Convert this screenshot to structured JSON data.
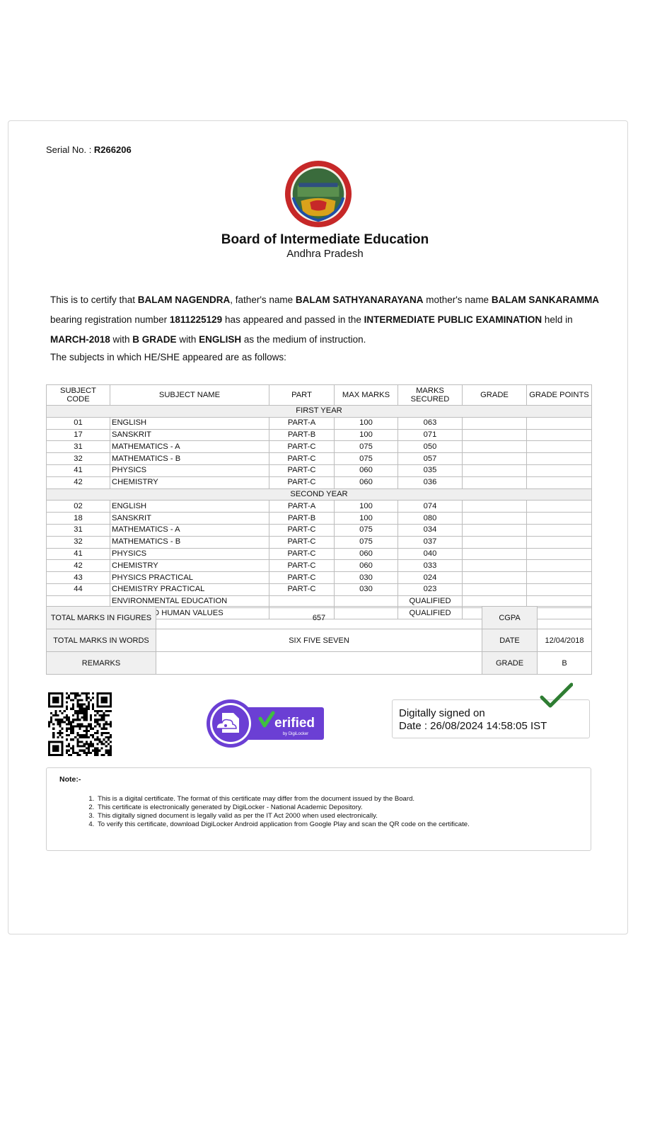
{
  "serial": {
    "label": "Serial No. : ",
    "value": "R266206"
  },
  "header": {
    "title": "Board of Intermediate Education",
    "subtitle": "Andhra Pradesh"
  },
  "certificate": {
    "t1": "This is to certify that ",
    "name": "BALAM NAGENDRA",
    "t2": ", father's name ",
    "father": "BALAM SATHYANARAYANA",
    "t3": " mother's name ",
    "mother": "BALAM SANKARAMMA",
    "t4": " bearing registration number ",
    "regno": "1811225129",
    "t5": " has appeared and passed in the ",
    "exam": "INTERMEDIATE PUBLIC EXAMINATION",
    "t6": " held in ",
    "month": "MARCH-2018",
    "t7": " with ",
    "grade": "B GRADE",
    "t8": " with ",
    "medium": "ENGLISH",
    "t9": " as the medium of instruction.",
    "subjects_intro": "The subjects in which HE/SHE appeared are as follows:"
  },
  "table": {
    "headers": [
      "SUBJECT CODE",
      "SUBJECT NAME",
      "PART",
      "MAX MARKS",
      "MARKS SECURED",
      "GRADE",
      "GRADE POINTS"
    ],
    "first_year_label": "FIRST YEAR",
    "first_year": [
      [
        "01",
        "ENGLISH",
        "PART-A",
        "100",
        "063"
      ],
      [
        "17",
        "SANSKRIT",
        "PART-B",
        "100",
        "071"
      ],
      [
        "31",
        "MATHEMATICS - A",
        "PART-C",
        "075",
        "050"
      ],
      [
        "32",
        "MATHEMATICS - B",
        "PART-C",
        "075",
        "057"
      ],
      [
        "41",
        "PHYSICS",
        "PART-C",
        "060",
        "035"
      ],
      [
        "42",
        "CHEMISTRY",
        "PART-C",
        "060",
        "036"
      ]
    ],
    "second_year_label": "SECOND YEAR",
    "second_year": [
      [
        "02",
        "ENGLISH",
        "PART-A",
        "100",
        "074"
      ],
      [
        "18",
        "SANSKRIT",
        "PART-B",
        "100",
        "080"
      ],
      [
        "31",
        "MATHEMATICS - A",
        "PART-C",
        "075",
        "034"
      ],
      [
        "32",
        "MATHEMATICS - B",
        "PART-C",
        "075",
        "037"
      ],
      [
        "41",
        "PHYSICS",
        "PART-C",
        "060",
        "040"
      ],
      [
        "42",
        "CHEMISTRY",
        "PART-C",
        "060",
        "033"
      ],
      [
        "43",
        "PHYSICS PRACTICAL",
        "PART-C",
        "030",
        "024"
      ],
      [
        "44",
        "CHEMISTRY PRACTICAL",
        "PART-C",
        "030",
        "023"
      ],
      [
        "",
        "ENVIRONMENTAL EDUCATION",
        "",
        "",
        "QUALIFIED"
      ],
      [
        "",
        "ETHICS AND HUMAN VALUES",
        "",
        "",
        "QUALIFIED"
      ]
    ]
  },
  "totals": {
    "figures_label": "TOTAL MARKS IN FIGURES",
    "figures": "657",
    "cgpa_label": "CGPA",
    "cgpa": "",
    "words_label": "TOTAL MARKS IN WORDS",
    "words": "SIX FIVE SEVEN",
    "date_label": "DATE",
    "date": "12/04/2018",
    "remarks_label": "REMARKS",
    "remarks": "",
    "grade_label": "GRADE",
    "grade": "B"
  },
  "verified": {
    "text": "erified",
    "by": "by DigiLocker",
    "color": "#6b3fd4"
  },
  "signature": {
    "line1": "Digitally signed on",
    "line2": "Date : 26/08/2024 14:58:05 IST",
    "check_color": "#2e7d32"
  },
  "note": {
    "title": "Note:-",
    "items": [
      "This is a digital certificate. The format of this certificate may differ from the document issued by the Board.",
      "This certificate is electronically generated by DigiLocker - National Academic Depository.",
      "This digitally signed document is legally valid as per the IT Act 2000 when used electronically.",
      "To verify this certificate, download DigiLocker Android application from Google Play and scan the QR code on the certificate."
    ]
  }
}
